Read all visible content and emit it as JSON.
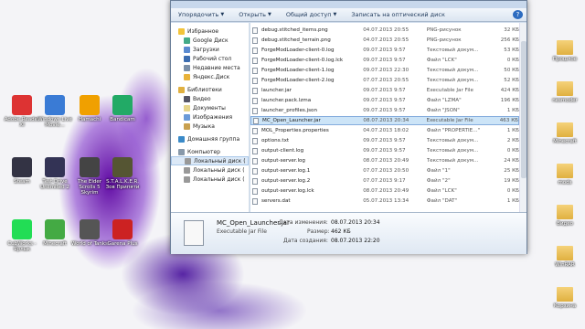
{
  "desktop": {
    "icons": [
      {
        "label": "Adobe Reader XI",
        "color": "#d33"
      },
      {
        "label": "Windows Live Movie...",
        "color": "#3a7bd5"
      },
      {
        "label": "Hamachi",
        "color": "#f0a000"
      },
      {
        "label": "Bandicam",
        "color": "#2a6"
      },
      {
        "label": "Steam",
        "color": "#334"
      },
      {
        "label": "Test Drive Unlimited 2",
        "color": "#335"
      },
      {
        "label": "The Elder Scrolls 5 Skyrim",
        "color": "#444"
      },
      {
        "label": "S.T.A.L.K.E.R. Зов Припяти",
        "color": "#553"
      },
      {
        "label": "CubWorks - Ярлык",
        "color": "#2d5"
      },
      {
        "label": "Minecraft",
        "color": "#4a4"
      },
      {
        "label": "World of Tanks",
        "color": "#555"
      },
      {
        "label": "Garena Plus",
        "color": "#c22"
      }
    ],
    "right_icons": [
      {
        "label": "Прошлое"
      },
      {
        "label": "nesmoder"
      },
      {
        "label": "Minecraft"
      },
      {
        "label": "mods"
      },
      {
        "label": "Видео"
      },
      {
        "label": "WinRAR"
      },
      {
        "label": "Корзина"
      }
    ]
  },
  "toolbar": {
    "organize": "Упорядочить",
    "open": "Открыть",
    "share": "Общий доступ",
    "burn": "Записать на оптический диск"
  },
  "nav": {
    "favorites": "Избранное",
    "google_disk": "Google Диск",
    "downloads": "Загрузки",
    "desktop": "Рабочий стол",
    "recent": "Недавние места",
    "yandex_disk": "Яндекс.Диск",
    "libraries": "Библиотеки",
    "video": "Видео",
    "documents": "Документы",
    "images": "Изображения",
    "music": "Музыка",
    "homegroup": "Домашняя группа",
    "computer": "Компьютер",
    "local_disk_1": "Локальный диск (",
    "local_disk_2": "Локальный диск (",
    "local_disk_3": "Локальный диск ("
  },
  "files": [
    {
      "name": "debug.stitched_items.png",
      "date": "04.07.2013 20:55",
      "type": "PNG-рисунок",
      "size": "32 КБ"
    },
    {
      "name": "debug.stitched_terrain.png",
      "date": "04.07.2013 20:55",
      "type": "PNG-рисунок",
      "size": "256 КБ"
    },
    {
      "name": "ForgeModLoader-client-0.log",
      "date": "09.07.2013 9:57",
      "type": "Текстовый докум...",
      "size": "53 КБ"
    },
    {
      "name": "ForgeModLoader-client-0.log.lck",
      "date": "09.07.2013 9:57",
      "type": "Файл \"LCK\"",
      "size": "0 КБ"
    },
    {
      "name": "ForgeModLoader-client-1.log",
      "date": "09.07.2013 22:30",
      "type": "Текстовый докум...",
      "size": "50 КБ"
    },
    {
      "name": "ForgeModLoader-client-2.log",
      "date": "07.07.2013 20:55",
      "type": "Текстовый докум...",
      "size": "52 КБ"
    },
    {
      "name": "launcher.jar",
      "date": "09.07.2013 9:57",
      "type": "Executable Jar File",
      "size": "424 КБ"
    },
    {
      "name": "launcher.pack.lzma",
      "date": "09.07.2013 9:57",
      "type": "Файл \"LZMA\"",
      "size": "196 КБ"
    },
    {
      "name": "launcher_profiles.json",
      "date": "09.07.2013 9:57",
      "type": "Файл \"JSON\"",
      "size": "1 КБ"
    },
    {
      "name": "MC_Open_Launcher.jar",
      "date": "08.07.2013 20:34",
      "type": "Executable Jar File",
      "size": "463 КБ"
    },
    {
      "name": "MOL_Properties.properties",
      "date": "04.07.2013 18:02",
      "type": "Файл \"PROPERTIE...\"",
      "size": "1 КБ"
    },
    {
      "name": "options.txt",
      "date": "09.07.2013 9:57",
      "type": "Текстовый докум...",
      "size": "2 КБ"
    },
    {
      "name": "output-client.log",
      "date": "09.07.2013 9:57",
      "type": "Текстовый докум...",
      "size": "0 КБ"
    },
    {
      "name": "output-server.log",
      "date": "08.07.2013 20:49",
      "type": "Текстовый докум...",
      "size": "24 КБ"
    },
    {
      "name": "output-server.log.1",
      "date": "07.07.2013 20:50",
      "type": "Файл \"1\"",
      "size": "25 КБ"
    },
    {
      "name": "output-server.log.2",
      "date": "07.07.2013 9:17",
      "type": "Файл \"2\"",
      "size": "19 КБ"
    },
    {
      "name": "output-server.log.lck",
      "date": "08.07.2013 20:49",
      "type": "Файл \"LCK\"",
      "size": "0 КБ"
    },
    {
      "name": "servers.dat",
      "date": "05.07.2013 13:34",
      "type": "Файл \"DAT\"",
      "size": "1 КБ"
    }
  ],
  "details": {
    "name": "MC_Open_Launcher.jar",
    "type": "Executable Jar File",
    "modified_label": "Дата изменения:",
    "modified": "08.07.2013 20:34",
    "size_label": "Размер:",
    "size": "462 КБ",
    "created_label": "Дата создания:",
    "created": "08.07.2013 22:20"
  }
}
